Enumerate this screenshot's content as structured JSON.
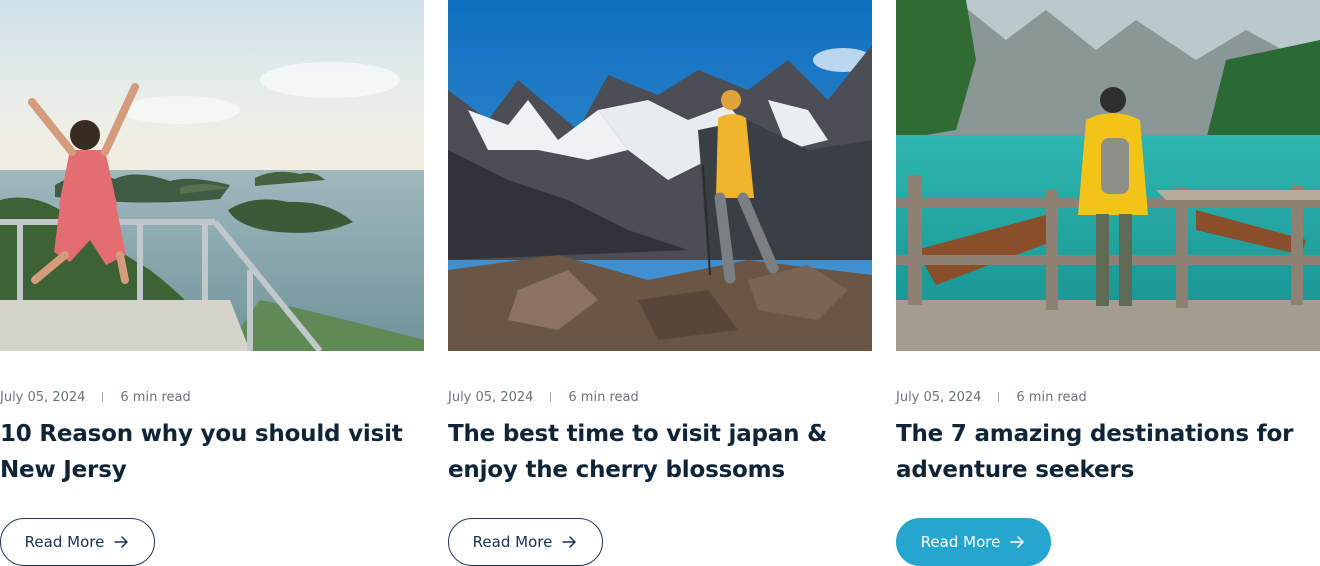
{
  "posts": [
    {
      "date": "July 05, 2024",
      "read_time": "6 min read",
      "title": "10 Reason why you should visit New Jersy",
      "button_label": "Read More",
      "image": "woman-jumping-on-viewpoint-over-islands"
    },
    {
      "date": "July 05, 2024",
      "read_time": "6 min read",
      "title": "The best time to visit japan & enjoy the cherry blossoms",
      "button_label": "Read More",
      "image": "hiker-in-yellow-jacket-snowy-mountains"
    },
    {
      "date": "July 05, 2024",
      "read_time": "6 min read",
      "title": "The 7 amazing destinations for adventure seekers",
      "button_label": "Read More",
      "image": "traveler-on-pier-turquoise-mountain-lake"
    }
  ],
  "colors": {
    "heading": "#0f2537",
    "meta": "#6b7280",
    "button_border": "#1f3a55",
    "button_active": "#24a6cf"
  },
  "icons": {
    "button": "arrow-right-icon"
  }
}
